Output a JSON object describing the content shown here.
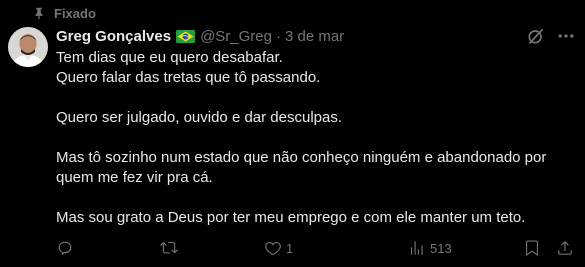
{
  "pinned": {
    "label": "Fixado",
    "icon": "pin-icon"
  },
  "author": {
    "name": "Greg Gonçalves",
    "flag": "brazil-flag-icon",
    "handle": "@Sr_Greg",
    "separator": "·",
    "date": "3 de mar"
  },
  "body": {
    "lines": [
      "Tem dias que eu quero desabafar.",
      "Quero falar das tretas que tô passando.",
      "Quero ser julgado, ouvido e dar desculpas.",
      "Mas tô sozinho num estado que não conheço ninguém e abandonado por",
      "quem me fez vir pra cá.",
      "Mas sou grato a Deus por ter meu emprego e com ele manter um teto."
    ]
  },
  "actions": {
    "reply": {
      "icon": "reply-icon",
      "count": ""
    },
    "repost": {
      "icon": "repost-icon",
      "count": ""
    },
    "like": {
      "icon": "heart-icon",
      "count": "1"
    },
    "views": {
      "icon": "views-icon",
      "count": "513"
    },
    "bookmark": {
      "icon": "bookmark-icon"
    },
    "share": {
      "icon": "share-icon"
    }
  },
  "colors": {
    "background": "#000000",
    "text": "#e7e9ea",
    "secondary": "#71767b"
  }
}
